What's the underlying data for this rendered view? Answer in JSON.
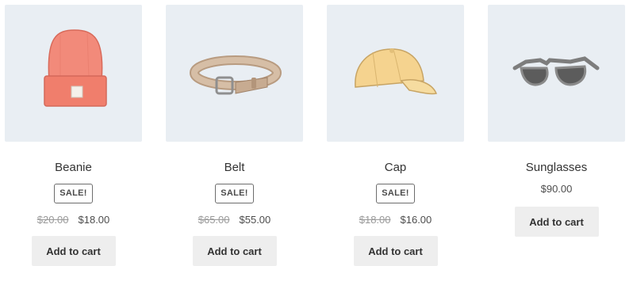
{
  "products": [
    {
      "name": "Beanie",
      "badge": "SALE!",
      "old_price": "$20.00",
      "price": "$18.00",
      "button": "Add to cart",
      "image": "beanie-image"
    },
    {
      "name": "Belt",
      "badge": "SALE!",
      "old_price": "$65.00",
      "price": "$55.00",
      "button": "Add to cart",
      "image": "belt-image"
    },
    {
      "name": "Cap",
      "badge": "SALE!",
      "old_price": "$18.00",
      "price": "$16.00",
      "button": "Add to cart",
      "image": "cap-image"
    },
    {
      "name": "Sunglasses",
      "price": "$90.00",
      "button": "Add to cart",
      "image": "sunglasses-image"
    }
  ],
  "colors": {
    "thumb_bg": "#e9eef3",
    "button_bg": "#eeeeee",
    "beanie": "#f28a7a",
    "belt": "#c9ad93",
    "cap": "#f5d38f",
    "glasses": "#7d7d7d"
  }
}
